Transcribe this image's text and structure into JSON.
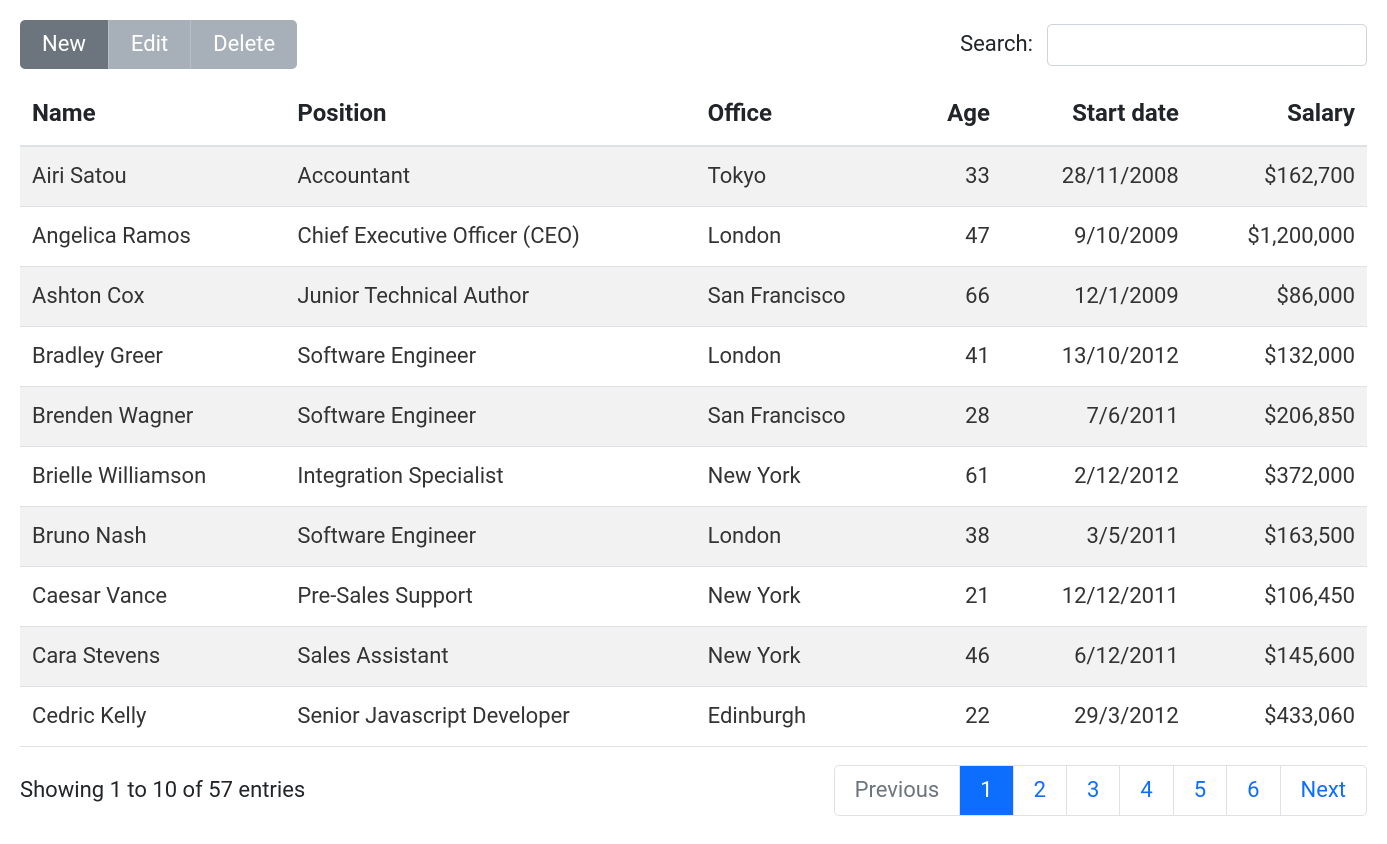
{
  "toolbar": {
    "new_label": "New",
    "edit_label": "Edit",
    "delete_label": "Delete"
  },
  "search": {
    "label": "Search:",
    "value": ""
  },
  "columns": [
    {
      "label": "Name",
      "align": "left"
    },
    {
      "label": "Position",
      "align": "left"
    },
    {
      "label": "Office",
      "align": "left"
    },
    {
      "label": "Age",
      "align": "right"
    },
    {
      "label": "Start date",
      "align": "right"
    },
    {
      "label": "Salary",
      "align": "right"
    }
  ],
  "rows": [
    {
      "name": "Airi Satou",
      "position": "Accountant",
      "office": "Tokyo",
      "age": "33",
      "start_date": "28/11/2008",
      "salary": "$162,700"
    },
    {
      "name": "Angelica Ramos",
      "position": "Chief Executive Officer (CEO)",
      "office": "London",
      "age": "47",
      "start_date": "9/10/2009",
      "salary": "$1,200,000"
    },
    {
      "name": "Ashton Cox",
      "position": "Junior Technical Author",
      "office": "San Francisco",
      "age": "66",
      "start_date": "12/1/2009",
      "salary": "$86,000"
    },
    {
      "name": "Bradley Greer",
      "position": "Software Engineer",
      "office": "London",
      "age": "41",
      "start_date": "13/10/2012",
      "salary": "$132,000"
    },
    {
      "name": "Brenden Wagner",
      "position": "Software Engineer",
      "office": "San Francisco",
      "age": "28",
      "start_date": "7/6/2011",
      "salary": "$206,850"
    },
    {
      "name": "Brielle Williamson",
      "position": "Integration Specialist",
      "office": "New York",
      "age": "61",
      "start_date": "2/12/2012",
      "salary": "$372,000"
    },
    {
      "name": "Bruno Nash",
      "position": "Software Engineer",
      "office": "London",
      "age": "38",
      "start_date": "3/5/2011",
      "salary": "$163,500"
    },
    {
      "name": "Caesar Vance",
      "position": "Pre-Sales Support",
      "office": "New York",
      "age": "21",
      "start_date": "12/12/2011",
      "salary": "$106,450"
    },
    {
      "name": "Cara Stevens",
      "position": "Sales Assistant",
      "office": "New York",
      "age": "46",
      "start_date": "6/12/2011",
      "salary": "$145,600"
    },
    {
      "name": "Cedric Kelly",
      "position": "Senior Javascript Developer",
      "office": "Edinburgh",
      "age": "22",
      "start_date": "29/3/2012",
      "salary": "$433,060"
    }
  ],
  "info": "Showing 1 to 10 of 57 entries",
  "pagination": {
    "previous_label": "Previous",
    "next_label": "Next",
    "pages": [
      "1",
      "2",
      "3",
      "4",
      "5",
      "6"
    ],
    "active": "1",
    "previous_disabled": true,
    "next_disabled": false
  }
}
